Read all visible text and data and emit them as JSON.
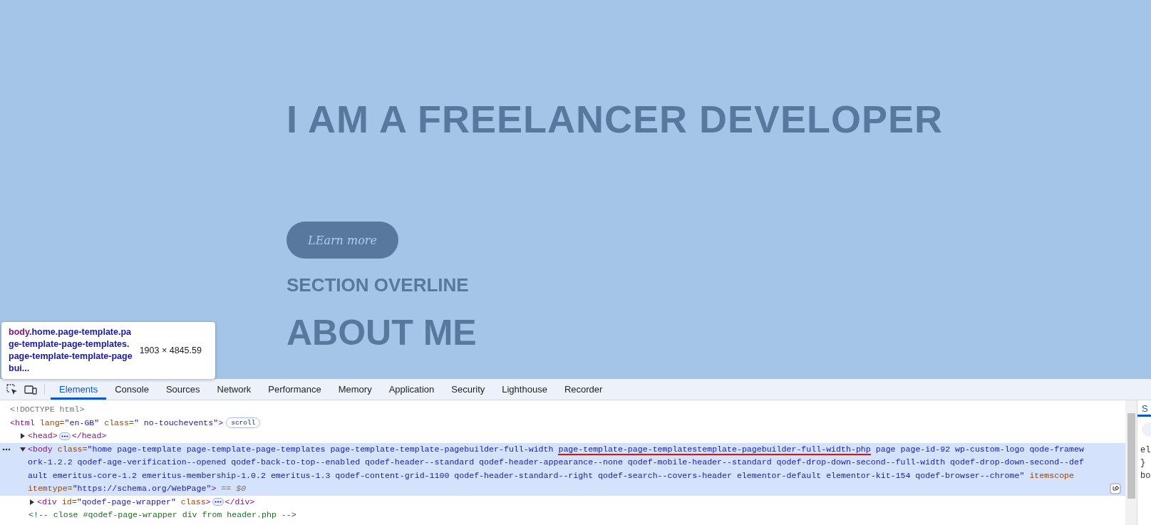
{
  "page": {
    "headline": "I AM A FREELANCER DEVELOPER",
    "button": "LEarn more",
    "overline": "SECTION OVERLINE",
    "heading": "ABOUT ME"
  },
  "tooltip": {
    "tag": "body",
    "class_lines": [
      ".home.page-template.pa",
      "ge-template-page-templates.",
      "page-template-template-page",
      "bui..."
    ],
    "size": "1903 × 4845.59"
  },
  "devtools": {
    "tabs": [
      {
        "label": "Elements",
        "selected": true
      },
      {
        "label": "Console",
        "selected": false
      },
      {
        "label": "Sources",
        "selected": false
      },
      {
        "label": "Network",
        "selected": false
      },
      {
        "label": "Performance",
        "selected": false
      },
      {
        "label": "Memory",
        "selected": false
      },
      {
        "label": "Application",
        "selected": false
      },
      {
        "label": "Security",
        "selected": false
      },
      {
        "label": "Lighthouse",
        "selected": false
      },
      {
        "label": "Recorder",
        "selected": false
      }
    ],
    "dom": [
      {
        "lines": [
          [
            {
              "kind": "doctype",
              "text": "<!DOCTYPE html>"
            }
          ]
        ]
      },
      {
        "lines": [
          [
            {
              "kind": "tag",
              "text": "<html"
            },
            {
              "kind": "attr",
              "text": " lang="
            },
            {
              "kind": "value",
              "text": "\"en-GB\""
            },
            {
              "kind": "attr",
              "text": " class="
            },
            {
              "kind": "value",
              "text": "\" no-touchevents\""
            },
            {
              "kind": "tag",
              "text": ">"
            },
            {
              "kind": "badge",
              "text": "scroll"
            }
          ]
        ],
        "children": [
          {
            "expanded": false,
            "lines": [
              [
                {
                  "kind": "tag",
                  "text": "<head>"
                },
                {
                  "kind": "ellipsis"
                },
                {
                  "kind": "tag",
                  "text": "</head>"
                }
              ]
            ]
          },
          {
            "expanded": true,
            "selected": true,
            "lines": [
              [
                {
                  "kind": "tag",
                  "text": "<body"
                },
                {
                  "kind": "attr",
                  "text": " class="
                },
                {
                  "kind": "value",
                  "text": "\"home page-template page-template-page-templates page-template-template-pagebuilder-full-width "
                },
                {
                  "kind": "value",
                  "text": "page-template-page-templatestemplate-pagebuilder-full-width-php",
                  "underlined": true
                },
                {
                  "kind": "value",
                  "text": " page page-id-92 wp-custom-logo qode-framew"
                }
              ],
              [
                {
                  "kind": "value",
                  "text": "ork-1.2.2 qodef-age-verification--opened qodef-back-to-top--enabled qodef-header--standard qodef-header-appearance--none qodef-mobile-header--standard qodef-drop-down-second--full-width qodef-drop-down-second--def"
                }
              ],
              [
                {
                  "kind": "value",
                  "text": "ault emeritus-core-1.2 emeritus-membership-1.0.2 emeritus-1.3 qodef-content-grid-1100 qodef-header-standard--right qodef-search--covers-header elementor-default elementor-kit-154 qodef-browser--chrome\""
                },
                {
                  "kind": "attr",
                  "text": " itemscope"
                }
              ],
              [
                {
                  "kind": "attr",
                  "text": "itemtype="
                },
                {
                  "kind": "value",
                  "text": "\"https://schema.org/WebPage\""
                },
                {
                  "kind": "tag",
                  "text": ">"
                },
                {
                  "kind": "hint",
                  "text": " == $0"
                }
              ]
            ],
            "children": [
              {
                "expanded": false,
                "lines": [
                  [
                    {
                      "kind": "tag",
                      "text": "<div"
                    },
                    {
                      "kind": "attr",
                      "text": " id="
                    },
                    {
                      "kind": "value",
                      "text": "\"qodef-page-wrapper\""
                    },
                    {
                      "kind": "attr",
                      "text": " class"
                    },
                    {
                      "kind": "tag",
                      "text": ">"
                    },
                    {
                      "kind": "ellipsis"
                    },
                    {
                      "kind": "tag",
                      "text": "</div>"
                    }
                  ]
                ]
              },
              {
                "lines": [
                  [
                    {
                      "kind": "comment",
                      "text": "<!-- close #qodef-page-wrapper div from header.php -->"
                    }
                  ]
                ]
              }
            ]
          }
        ]
      }
    ],
    "styles_panel": {
      "tab": {
        "label": "S",
        "selected": true
      },
      "lines": [
        "el",
        "}",
        "bo"
      ]
    }
  }
}
